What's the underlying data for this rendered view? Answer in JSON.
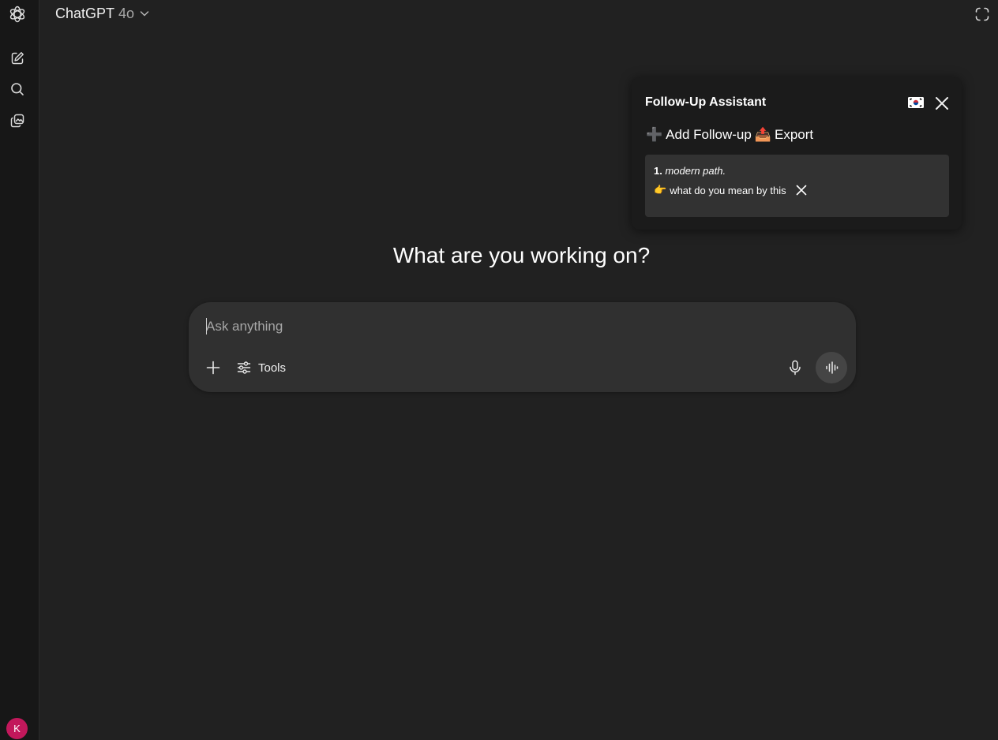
{
  "header": {
    "model_name": "ChatGPT",
    "model_version": "4o"
  },
  "sidebar": {
    "icons": [
      "openai-logo-icon",
      "new-chat-icon",
      "search-icon",
      "library-icon"
    ],
    "avatar_initial": "K",
    "avatar_color": "#c2185b"
  },
  "followup_panel": {
    "title": "Follow-Up Assistant",
    "flag_emoji": "🇰🇷",
    "add_label": "Add Follow-up",
    "add_emoji": "➕",
    "export_label": "Export",
    "export_emoji": "📤",
    "items": [
      {
        "number": "1.",
        "source": "modern path.",
        "question_emoji": "👉",
        "question": "what do you mean by this"
      }
    ]
  },
  "main": {
    "headline": "What are you working on?"
  },
  "composer": {
    "placeholder": "Ask anything",
    "tools_label": "Tools"
  }
}
